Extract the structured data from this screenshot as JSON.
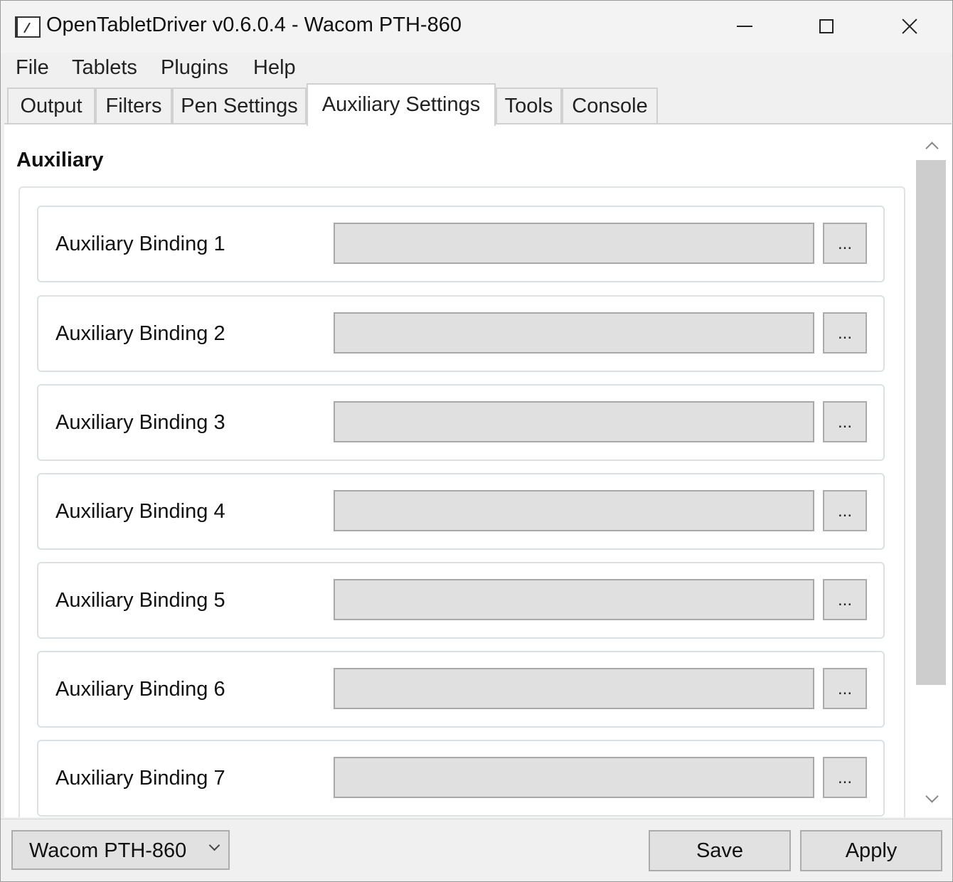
{
  "window": {
    "title": "OpenTabletDriver v0.6.0.4 - Wacom PTH-860"
  },
  "menu": {
    "items": [
      "File",
      "Tablets",
      "Plugins",
      "Help"
    ]
  },
  "tabs": {
    "items": [
      "Output",
      "Filters",
      "Pen Settings",
      "Auxiliary Settings",
      "Tools",
      "Console"
    ],
    "active": "Auxiliary Settings"
  },
  "content": {
    "section_title": "Auxiliary",
    "bindings": [
      {
        "label": "Auxiliary Binding 1",
        "value": "",
        "button": "..."
      },
      {
        "label": "Auxiliary Binding 2",
        "value": "",
        "button": "..."
      },
      {
        "label": "Auxiliary Binding 3",
        "value": "",
        "button": "..."
      },
      {
        "label": "Auxiliary Binding 4",
        "value": "",
        "button": "..."
      },
      {
        "label": "Auxiliary Binding 5",
        "value": "",
        "button": "..."
      },
      {
        "label": "Auxiliary Binding 6",
        "value": "",
        "button": "..."
      },
      {
        "label": "Auxiliary Binding 7",
        "value": "",
        "button": "..."
      }
    ]
  },
  "footer": {
    "tablet_selected": "Wacom PTH-860",
    "save_label": "Save",
    "apply_label": "Apply"
  },
  "icons": {
    "app": "opentabletdriver-app-icon",
    "minimize": "minimize-icon",
    "maximize": "maximize-icon",
    "close": "close-icon",
    "dropdown": "chevron-down-icon",
    "scroll_up": "chevron-up-icon",
    "scroll_down": "chevron-down-icon"
  }
}
